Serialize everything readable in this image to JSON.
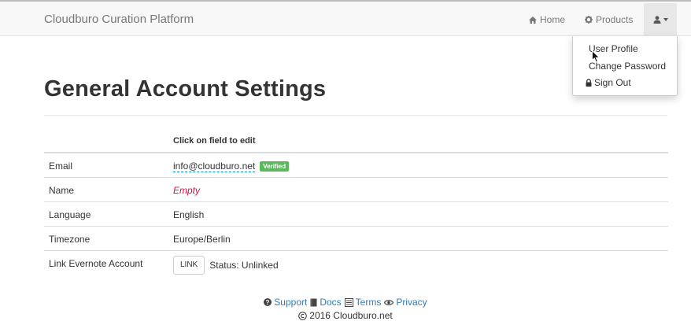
{
  "navbar": {
    "brand": "Cloudburo Curation Platform",
    "home_label": "Home",
    "products_label": "Products",
    "icons": {
      "home": "home-icon",
      "products": "gear-icon",
      "user": "user-icon"
    }
  },
  "user_menu": {
    "items": [
      {
        "label": "User Profile"
      },
      {
        "label": "Change Password"
      },
      {
        "label": "Sign Out",
        "icon": "lock-icon"
      }
    ]
  },
  "page": {
    "title": "General Account Settings"
  },
  "settings_table": {
    "header_hint": "Click on field to edit",
    "rows": [
      {
        "label": "Email",
        "value": "info@cloudburo.net",
        "badge": "Verified"
      },
      {
        "label": "Name",
        "value": "Empty"
      },
      {
        "label": "Language",
        "value": "English"
      },
      {
        "label": "Timezone",
        "value": "Europe/Berlin"
      },
      {
        "label": "Link Evernote Account",
        "button": "LINK",
        "status": "Status: Unlinked"
      }
    ]
  },
  "footer": {
    "links": [
      {
        "label": "Support",
        "icon": "question-circle-icon"
      },
      {
        "label": "Docs",
        "icon": "book-icon"
      },
      {
        "label": "Terms",
        "icon": "list-icon"
      },
      {
        "label": "Privacy",
        "icon": "eye-icon"
      }
    ],
    "copyright": "2016 Cloudburo.net"
  },
  "colors": {
    "navbar_bg": "#f8f8f8",
    "link": "#337ab7",
    "badge_success": "#5cb85c",
    "empty_value": "#dd1144",
    "editable_underline": "#0088cc"
  }
}
